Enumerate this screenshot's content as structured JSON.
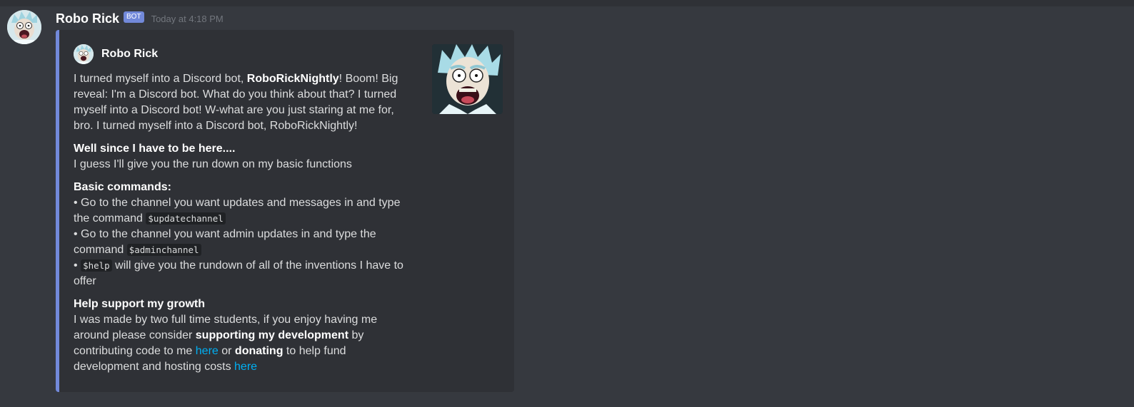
{
  "message": {
    "author": "Robo Rick",
    "badge": "BOT",
    "timestamp": "Today at 4:18 PM"
  },
  "embed": {
    "author": "Robo Rick",
    "accent_color": "#7289da",
    "description": {
      "before": "I turned myself into a Discord bot, ",
      "bold": "RoboRickNightly",
      "after": "! Boom! Big reveal: I'm a Discord bot. What do you think about that? I turned myself into a Discord bot! W-what are you just staring at me for, bro. I turned myself into a Discord bot, RoboRickNightly!"
    },
    "fields": {
      "intro": {
        "name": "Well since I have to be here....",
        "value": "I guess I'll give you the run down on my basic functions"
      },
      "commands": {
        "name": "Basic commands:",
        "bullet": "•",
        "item1": {
          "text": " Go to the channel you want updates and messages in and type the command ",
          "code": "$updatechannel"
        },
        "item2": {
          "text": " Go to the channel you want admin updates in and type the command ",
          "code": "$adminchannel"
        },
        "item3": {
          "code": "$help",
          "text": " will give you the rundown of all of the inventions I have to offer"
        }
      },
      "support": {
        "name": "Help support my growth",
        "part1": "I was made by two full time students, if you enjoy having me around please consider ",
        "bold1": "supporting my development",
        "part2": " by contributing code to me ",
        "link1": "here",
        "part3": " or ",
        "bold2": "donating",
        "part4": " to help fund development and hosting costs ",
        "link2": "here"
      }
    }
  },
  "icons": {
    "avatar": "rick-avatar-icon",
    "thumbnail": "rick-thumbnail-image"
  }
}
